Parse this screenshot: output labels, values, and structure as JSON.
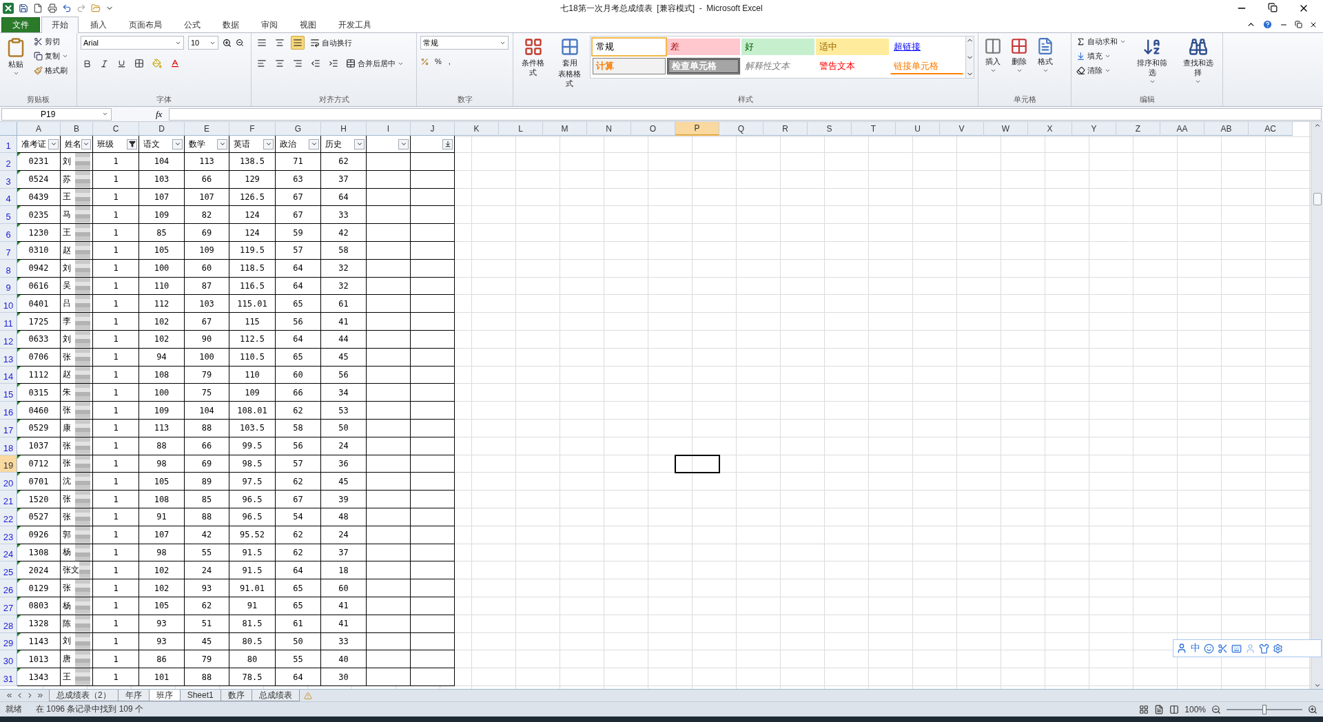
{
  "window": {
    "title": "七18第一次月考总成绩表  [兼容模式]  -  Microsoft Excel"
  },
  "tabs": [
    {
      "label": "文件",
      "kind": "file",
      "selected": false
    },
    {
      "label": "开始",
      "kind": "tab",
      "selected": true
    },
    {
      "label": "插入",
      "kind": "tab",
      "selected": false
    },
    {
      "label": "页面布局",
      "kind": "tab",
      "selected": false
    },
    {
      "label": "公式",
      "kind": "tab",
      "selected": false
    },
    {
      "label": "数据",
      "kind": "tab",
      "selected": false
    },
    {
      "label": "审阅",
      "kind": "tab",
      "selected": false
    },
    {
      "label": "视图",
      "kind": "tab",
      "selected": false
    },
    {
      "label": "开发工具",
      "kind": "tab",
      "selected": false
    }
  ],
  "ribbon": {
    "clipboard": {
      "label": "剪贴板",
      "paste": "粘贴",
      "cut": "剪切",
      "copy": "复制",
      "painter": "格式刷"
    },
    "font": {
      "label": "字体",
      "font_name": "Arial",
      "font_size": "10"
    },
    "alignment": {
      "label": "对齐方式",
      "wrap": "自动换行",
      "merge": "合并后居中"
    },
    "number": {
      "label": "数字",
      "format": "常规",
      "percent": "%",
      "comma": ","
    },
    "styles": {
      "label": "样式",
      "conditional": "条件格式",
      "table_1": "套用",
      "table_2": "表格格式",
      "cell_styles": [
        {
          "label": "常规",
          "kind": "normal",
          "selected": true
        },
        {
          "label": "差",
          "kind": "bad",
          "selected": false
        },
        {
          "label": "好",
          "kind": "good",
          "selected": false
        },
        {
          "label": "适中",
          "kind": "neutral",
          "selected": false
        },
        {
          "label": "超链接",
          "kind": "hyperlink",
          "selected": false
        },
        {
          "label": "计算",
          "kind": "calc",
          "selected": false
        },
        {
          "label": "检查单元格",
          "kind": "check",
          "selected": false
        },
        {
          "label": "解释性文本",
          "kind": "explanatory",
          "selected": false
        },
        {
          "label": "警告文本",
          "kind": "warning",
          "selected": false
        },
        {
          "label": "链接单元格",
          "kind": "linked",
          "selected": false
        }
      ]
    },
    "cells": {
      "label": "单元格",
      "insert": "插入",
      "delete": "删除",
      "format": "格式"
    },
    "editing": {
      "label": "编辑",
      "autosum": "自动求和",
      "fill": "填充",
      "clear": "清除",
      "sort": "排序和筛选",
      "find": "查找和选择"
    }
  },
  "formula_bar": {
    "name_box": "P19",
    "fx": "fx"
  },
  "columns": [
    {
      "label": "A",
      "selected": false
    },
    {
      "label": "B",
      "selected": false
    },
    {
      "label": "C",
      "selected": false
    },
    {
      "label": "D",
      "selected": false
    },
    {
      "label": "E",
      "selected": false
    },
    {
      "label": "F",
      "selected": false
    },
    {
      "label": "G",
      "selected": false
    },
    {
      "label": "H",
      "selected": false
    },
    {
      "label": "I",
      "selected": false
    },
    {
      "label": "J",
      "selected": false
    },
    {
      "label": "K",
      "selected": false
    },
    {
      "label": "L",
      "selected": false
    },
    {
      "label": "M",
      "selected": false
    },
    {
      "label": "N",
      "selected": false
    },
    {
      "label": "O",
      "selected": false
    },
    {
      "label": "P",
      "selected": true
    },
    {
      "label": "Q",
      "selected": false
    },
    {
      "label": "R",
      "selected": false
    },
    {
      "label": "S",
      "selected": false
    },
    {
      "label": "T",
      "selected": false
    },
    {
      "label": "U",
      "selected": false
    },
    {
      "label": "V",
      "selected": false
    },
    {
      "label": "W",
      "selected": false
    },
    {
      "label": "X",
      "selected": false
    },
    {
      "label": "Y",
      "selected": false
    },
    {
      "label": "Z",
      "selected": false
    },
    {
      "label": "AA",
      "selected": false
    },
    {
      "label": "AB",
      "selected": false
    },
    {
      "label": "AC",
      "selected": false
    }
  ],
  "header_row": {
    "num": "1",
    "selected": false,
    "headers": [
      {
        "text": "准考证",
        "filtered": false,
        "sorted": false
      },
      {
        "text": "姓名",
        "filtered": false,
        "sorted": false
      },
      {
        "text": "班级",
        "filtered": true,
        "sorted": false
      },
      {
        "text": "语文",
        "filtered": false,
        "sorted": false
      },
      {
        "text": "数学",
        "filtered": false,
        "sorted": false
      },
      {
        "text": "英语",
        "filtered": false,
        "sorted": false
      },
      {
        "text": "政治",
        "filtered": false,
        "sorted": false
      },
      {
        "text": "历史",
        "filtered": false,
        "sorted": false
      },
      {
        "filtered": false,
        "sorted": false
      },
      {
        "filtered": false,
        "sorted": true
      }
    ]
  },
  "rows": [
    {
      "num": "2",
      "selected": false,
      "cells": [
        "0231",
        "刘",
        "1",
        "104",
        "113",
        "138.5",
        "71",
        "62"
      ]
    },
    {
      "num": "3",
      "selected": false,
      "cells": [
        "0524",
        "苏",
        "1",
        "103",
        "66",
        "129",
        "63",
        "37"
      ]
    },
    {
      "num": "4",
      "selected": false,
      "cells": [
        "0439",
        "王",
        "1",
        "107",
        "107",
        "126.5",
        "67",
        "64"
      ]
    },
    {
      "num": "5",
      "selected": false,
      "cells": [
        "0235",
        "马",
        "1",
        "109",
        "82",
        "124",
        "67",
        "33"
      ]
    },
    {
      "num": "6",
      "selected": false,
      "cells": [
        "1230",
        "王",
        "1",
        "85",
        "69",
        "124",
        "59",
        "42"
      ]
    },
    {
      "num": "7",
      "selected": false,
      "cells": [
        "0310",
        "赵",
        "1",
        "105",
        "109",
        "119.5",
        "57",
        "58"
      ]
    },
    {
      "num": "8",
      "selected": false,
      "cells": [
        "0942",
        "刘",
        "1",
        "100",
        "60",
        "118.5",
        "64",
        "32"
      ]
    },
    {
      "num": "9",
      "selected": false,
      "cells": [
        "0616",
        "吴",
        "1",
        "110",
        "87",
        "116.5",
        "64",
        "32"
      ]
    },
    {
      "num": "10",
      "selected": false,
      "cells": [
        "0401",
        "吕",
        "1",
        "112",
        "103",
        "115.01",
        "65",
        "61"
      ]
    },
    {
      "num": "11",
      "selected": false,
      "cells": [
        "1725",
        "李",
        "1",
        "102",
        "67",
        "115",
        "56",
        "41"
      ]
    },
    {
      "num": "12",
      "selected": false,
      "cells": [
        "0633",
        "刘",
        "1",
        "102",
        "90",
        "112.5",
        "64",
        "44"
      ]
    },
    {
      "num": "13",
      "selected": false,
      "cells": [
        "0706",
        "张",
        "1",
        "94",
        "100",
        "110.5",
        "65",
        "45"
      ]
    },
    {
      "num": "14",
      "selected": false,
      "cells": [
        "1112",
        "赵",
        "1",
        "108",
        "79",
        "110",
        "60",
        "56"
      ]
    },
    {
      "num": "15",
      "selected": false,
      "cells": [
        "0315",
        "朱",
        "1",
        "100",
        "75",
        "109",
        "66",
        "34"
      ]
    },
    {
      "num": "16",
      "selected": false,
      "cells": [
        "0460",
        "张",
        "1",
        "109",
        "104",
        "108.01",
        "62",
        "53"
      ]
    },
    {
      "num": "17",
      "selected": false,
      "cells": [
        "0529",
        "康",
        "1",
        "113",
        "88",
        "103.5",
        "58",
        "50"
      ]
    },
    {
      "num": "18",
      "selected": false,
      "cells": [
        "1037",
        "张",
        "1",
        "88",
        "66",
        "99.5",
        "56",
        "24"
      ]
    },
    {
      "num": "19",
      "selected": true,
      "cells": [
        "0712",
        "张",
        "1",
        "98",
        "69",
        "98.5",
        "57",
        "36"
      ]
    },
    {
      "num": "20",
      "selected": false,
      "cells": [
        "0701",
        "沈",
        "1",
        "105",
        "89",
        "97.5",
        "62",
        "45"
      ]
    },
    {
      "num": "21",
      "selected": false,
      "cells": [
        "1520",
        "张",
        "1",
        "108",
        "85",
        "96.5",
        "67",
        "39"
      ]
    },
    {
      "num": "22",
      "selected": false,
      "cells": [
        "0527",
        "张",
        "1",
        "91",
        "88",
        "96.5",
        "54",
        "48"
      ]
    },
    {
      "num": "23",
      "selected": false,
      "cells": [
        "0926",
        "郭",
        "1",
        "107",
        "42",
        "95.52",
        "62",
        "24"
      ]
    },
    {
      "num": "24",
      "selected": false,
      "cells": [
        "1308",
        "杨",
        "1",
        "98",
        "55",
        "91.5",
        "62",
        "37"
      ]
    },
    {
      "num": "25",
      "selected": false,
      "cells": [
        "2024",
        "张文",
        "1",
        "102",
        "24",
        "91.5",
        "64",
        "18"
      ]
    },
    {
      "num": "26",
      "selected": false,
      "cells": [
        "0129",
        "张",
        "1",
        "102",
        "93",
        "91.01",
        "65",
        "60"
      ]
    },
    {
      "num": "27",
      "selected": false,
      "cells": [
        "0803",
        "杨",
        "1",
        "105",
        "62",
        "91",
        "65",
        "41"
      ]
    },
    {
      "num": "28",
      "selected": false,
      "cells": [
        "1328",
        "陈",
        "1",
        "93",
        "51",
        "81.5",
        "61",
        "41"
      ]
    },
    {
      "num": "29",
      "selected": false,
      "cells": [
        "1143",
        "刘",
        "1",
        "93",
        "45",
        "80.5",
        "50",
        "33"
      ]
    },
    {
      "num": "30",
      "selected": false,
      "cells": [
        "1013",
        "唐",
        "1",
        "86",
        "79",
        "80",
        "55",
        "40"
      ]
    },
    {
      "num": "31",
      "selected": false,
      "cells": [
        "1343",
        "王",
        "1",
        "101",
        "88",
        "78.5",
        "64",
        "30"
      ]
    }
  ],
  "sheet_tabs": [
    {
      "label": "总成绩表（2）",
      "selected": false
    },
    {
      "label": "年序",
      "selected": false
    },
    {
      "label": "班序",
      "selected": true
    },
    {
      "label": "Sheet1",
      "selected": false
    },
    {
      "label": "数序",
      "selected": false
    },
    {
      "label": "总成绩表",
      "selected": false
    }
  ],
  "status_bar": {
    "ready": "就绪",
    "message": "在 1096 条记录中找到 109 个",
    "zoom": "100%",
    "zoom_slider": {
      "level": 0.5
    }
  },
  "ime_toolbar": {
    "mode": "中"
  }
}
